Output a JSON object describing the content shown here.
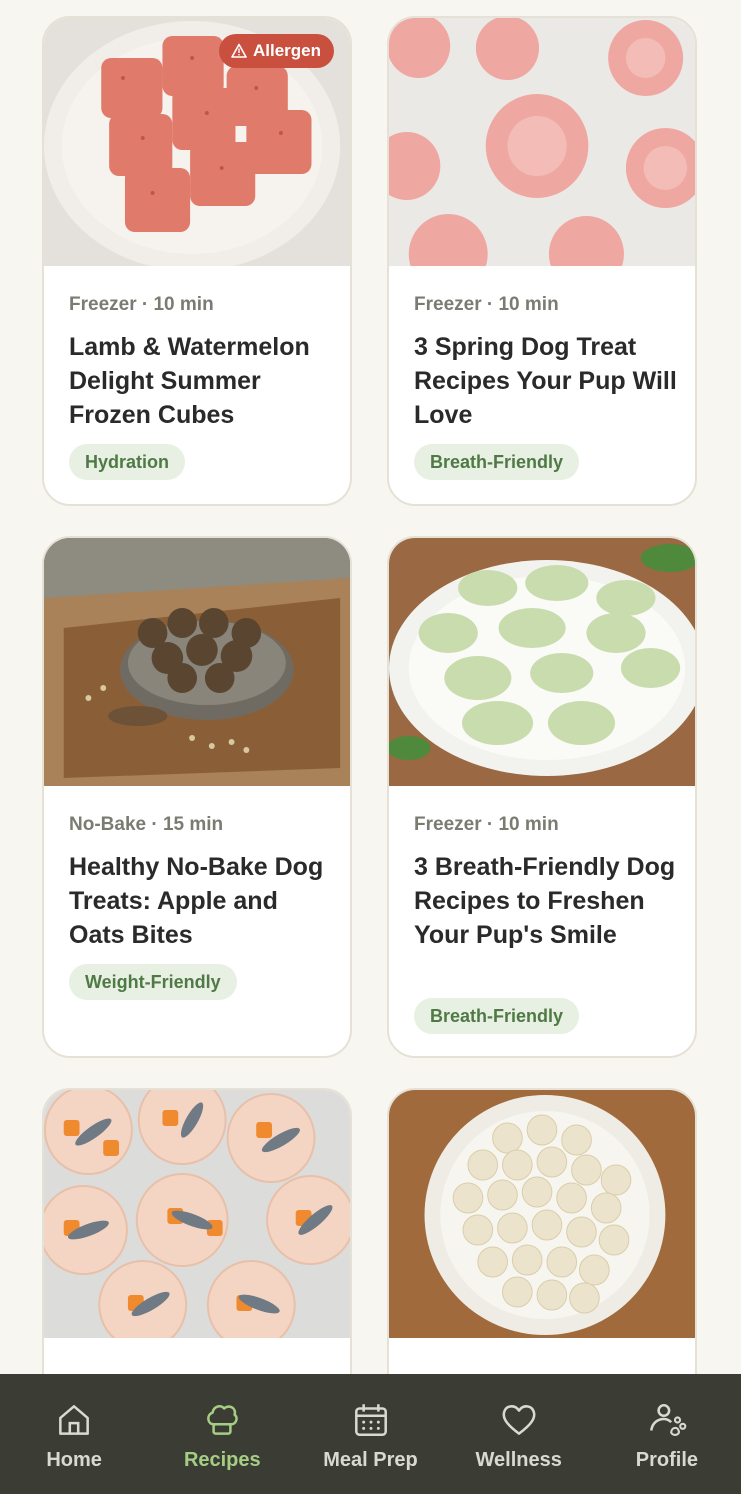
{
  "cards": [
    {
      "image": "frozen watermelon cubes on plate",
      "meta": "Freezer · 10 min",
      "title": "Lamb & Watermelon Delight Summer Frozen Cubes",
      "tag": "Hydration",
      "badge": "Allergen"
    },
    {
      "image": "pink flower-shaped frozen treats",
      "meta": "Freezer · 10 min",
      "title": "3 Spring Dog Treat Recipes Your Pup Will Love",
      "tag": "Breath-Friendly"
    },
    {
      "image": "oat balls in bowl on cutting board",
      "meta": "No-Bake · 15 min",
      "title": "Healthy No-Bake Dog Treats: Apple and Oats Bites",
      "tag": "Weight-Friendly"
    },
    {
      "image": "green paw and bone shaped treats on plate",
      "meta": "Freezer · 10 min",
      "title": "3 Breath-Friendly Dog Recipes to Freshen Your Pup's Smile",
      "tag": "Breath-Friendly"
    },
    {
      "image": "sardine and carrot jelly cups"
    },
    {
      "image": "white treat balls on plate"
    }
  ],
  "nav": [
    {
      "label": "Home",
      "icon": "home-icon",
      "active": false
    },
    {
      "label": "Recipes",
      "icon": "chef-hat-icon",
      "active": true
    },
    {
      "label": "Meal Prep",
      "icon": "calendar-icon",
      "active": false
    },
    {
      "label": "Wellness",
      "icon": "heart-icon",
      "active": false
    },
    {
      "label": "Profile",
      "icon": "paw-person-icon",
      "active": false
    }
  ],
  "colors": {
    "accent": "#a6cd84",
    "tag_bg": "#e7f0e2",
    "tag_text": "#4f7a45",
    "allergen": "#c9503e",
    "nav_bg": "#3b3d35"
  }
}
